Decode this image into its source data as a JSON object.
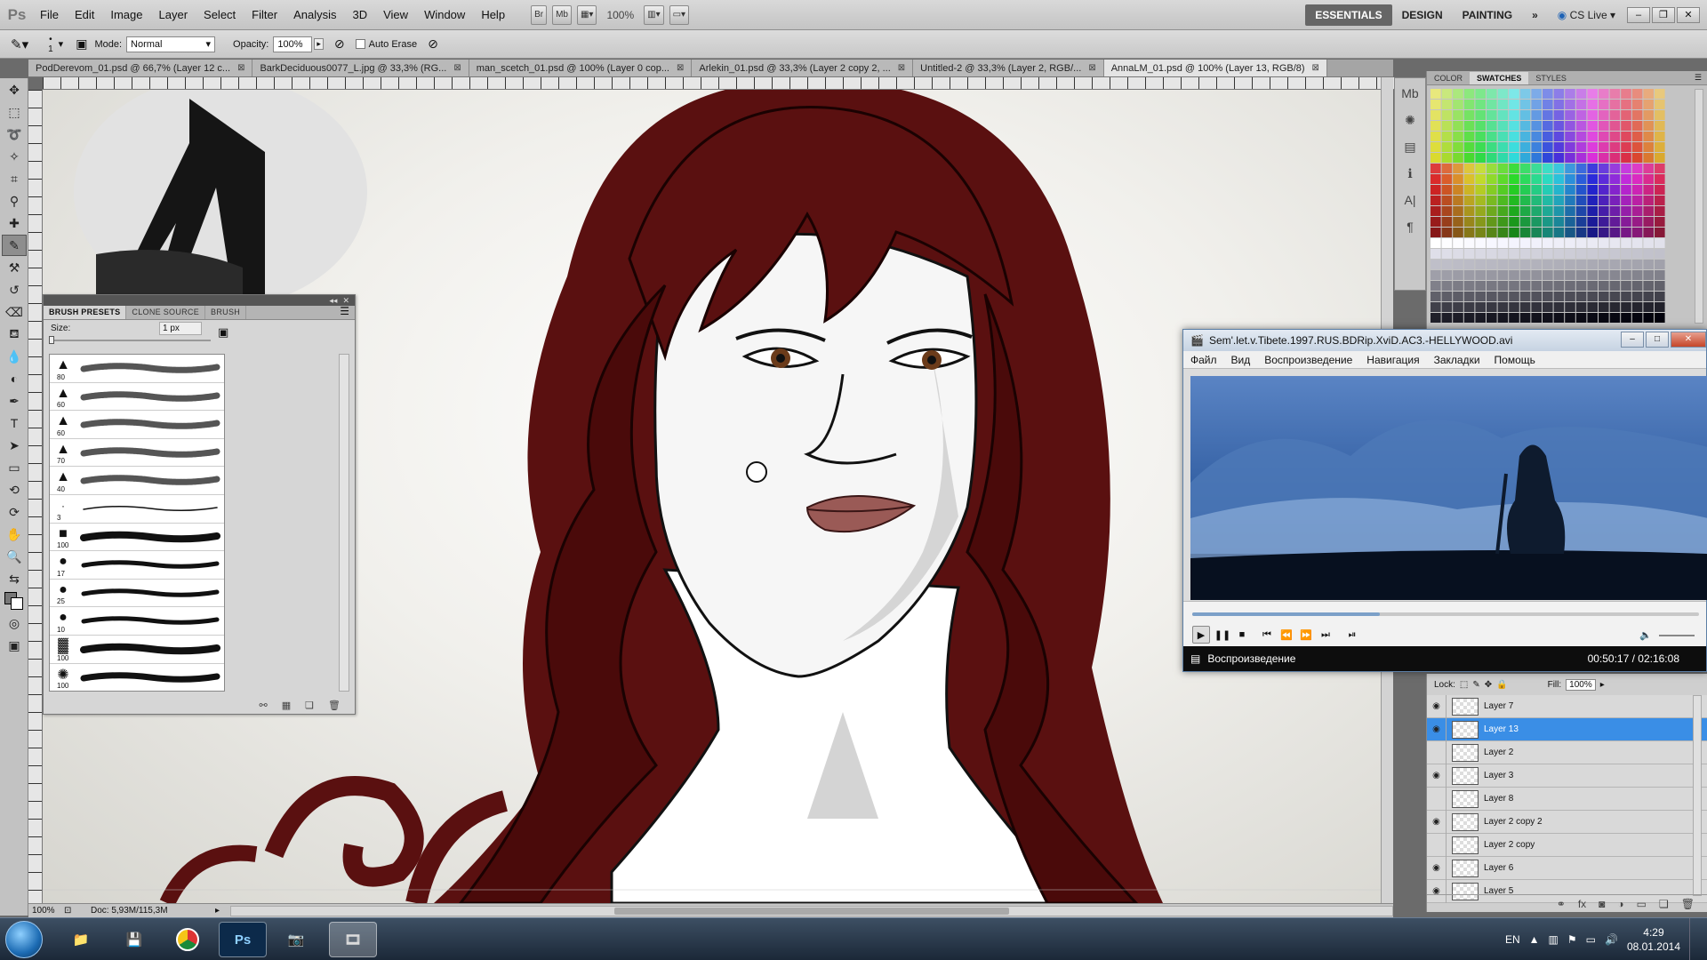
{
  "app": {
    "logo": "Ps"
  },
  "menu": [
    "File",
    "Edit",
    "Image",
    "Layer",
    "Select",
    "Filter",
    "Analysis",
    "3D",
    "View",
    "Window",
    "Help"
  ],
  "menubar_tools": {
    "bridge": "Br",
    "mini_bridge": "Mb",
    "zoom_value": "100%"
  },
  "workspaces": {
    "essentials": "ESSENTIALS",
    "design": "DESIGN",
    "painting": "PAINTING",
    "more": "»",
    "cs_live": "CS Live"
  },
  "options_bar": {
    "brush_size": "1",
    "mode_label": "Mode:",
    "mode_value": "Normal",
    "opacity_label": "Opacity:",
    "opacity_value": "100%",
    "auto_erase_label": "Auto Erase"
  },
  "doc_tabs": [
    "PodDerevom_01.psd @ 66,7% (Layer 12 c...",
    "BarkDeciduous0077_L.jpg @ 33,3% (RG...",
    "man_scetch_01.psd @ 100% (Layer 0 cop...",
    "Arlekin_01.psd @ 33,3% (Layer 2 copy 2, ...",
    "Untitled-2 @ 33,3% (Layer 2, RGB/...",
    "AnnaLM_01.psd @ 100% (Layer 13, RGB/8)"
  ],
  "status_bar": {
    "zoom": "100%",
    "doc_info": "Doc: 5,93M/115,3M"
  },
  "brush_panel": {
    "tabs": [
      "BRUSH PRESETS",
      "CLONE SOURCE",
      "BRUSH"
    ],
    "size_label": "Size:",
    "size_value": "1 px",
    "brushes": [
      {
        "size": "80",
        "tip": "triangle"
      },
      {
        "size": "60",
        "tip": "triangle"
      },
      {
        "size": "60",
        "tip": "triangle"
      },
      {
        "size": "70",
        "tip": "triangle"
      },
      {
        "size": "40",
        "tip": "triangle"
      },
      {
        "size": "3",
        "tip": "dot"
      },
      {
        "size": "100",
        "tip": "square"
      },
      {
        "size": "17",
        "tip": "circle"
      },
      {
        "size": "25",
        "tip": "circle"
      },
      {
        "size": "10",
        "tip": "circle"
      },
      {
        "size": "100",
        "tip": "rough"
      },
      {
        "size": "100",
        "tip": "splatter"
      }
    ]
  },
  "swatches_panel": {
    "tabs": [
      "COLOR",
      "SWATCHES",
      "STYLES"
    ]
  },
  "layers_panel": {
    "lock_label": "Lock:",
    "fill_label": "Fill:",
    "fill_value": "100%",
    "layers": [
      {
        "name": "Layer 7",
        "visible": true,
        "selected": false
      },
      {
        "name": "Layer 13",
        "visible": true,
        "selected": true
      },
      {
        "name": "Layer 2",
        "visible": false,
        "selected": false
      },
      {
        "name": "Layer 3",
        "visible": true,
        "selected": false
      },
      {
        "name": "Layer 8",
        "visible": false,
        "selected": false
      },
      {
        "name": "Layer 2 copy 2",
        "visible": true,
        "selected": false
      },
      {
        "name": "Layer 2 copy",
        "visible": false,
        "selected": false
      },
      {
        "name": "Layer 6",
        "visible": true,
        "selected": false
      },
      {
        "name": "Layer 5",
        "visible": true,
        "selected": false
      }
    ]
  },
  "player": {
    "title": "Sem'.let.v.Tibete.1997.RUS.BDRip.XviD.AC3.-HELLYWOOD.avi",
    "menu": [
      "Файл",
      "Вид",
      "Воспроизведение",
      "Навигация",
      "Закладки",
      "Помощь"
    ],
    "status": "Воспроизведение",
    "time": "00:50:17 / 02:16:08",
    "progress": 0.37
  },
  "taskbar": {
    "lang": "EN",
    "time": "4:29",
    "date": "08.01.2014"
  },
  "colors": {
    "hair": "#5a1010",
    "selected_layer": "#3a8ee6",
    "ui_gray": "#c4c4c4"
  }
}
